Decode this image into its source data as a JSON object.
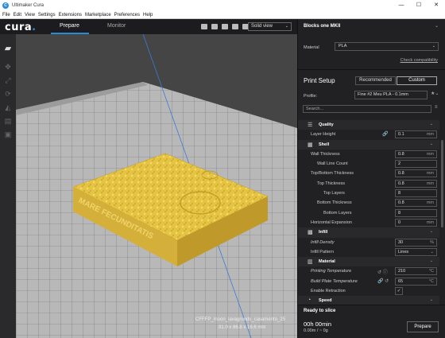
{
  "window": {
    "title": "Ultimaker Cura",
    "controls": [
      "—",
      "☐",
      "✕"
    ]
  },
  "menubar": [
    "File",
    "Edit",
    "View",
    "Settings",
    "Extensions",
    "Marketplace",
    "Preferences",
    "Help"
  ],
  "header": {
    "logo": "cura",
    "logo_dot": ".",
    "tabs": {
      "prepare": "Prepare",
      "monitor": "Monitor"
    },
    "view_mode": "Solid view",
    "view_icons": [
      "view-3d-icon",
      "view-front-icon",
      "view-top-icon",
      "view-left-icon",
      "view-right-icon"
    ]
  },
  "toolbar": {
    "open_icon": "📂",
    "tools": [
      "move-icon",
      "scale-icon",
      "rotate-icon",
      "mirror-icon",
      "per-model-settings-icon",
      "support-blocker-icon"
    ]
  },
  "viewport": {
    "model_name": "CFFFP_moon_lavagrunds_casamento_25",
    "model_dims": "81.0 x 86.8 x 16.6 mm",
    "model_text": "MARE FECUNDITATIS",
    "model_color": "#e8c646"
  },
  "panel": {
    "printer": "Blocks one MKII",
    "material_label": "Material",
    "material": "PLA",
    "check_compat": "Check compatibility",
    "print_setup": "Print Setup",
    "mode_recommended": "Recommended",
    "mode_custom": "Custom",
    "profile_label": "Profile:",
    "profile": "Fine #2 Meu PLA - 0.1mm",
    "search_placeholder": "Search..."
  },
  "settings": [
    {
      "type": "cat",
      "label": "Quality",
      "icon": "☰"
    },
    {
      "type": "row",
      "label": "Layer Height",
      "indent": 16,
      "value": "0.1",
      "unit": "mm",
      "icons": "🔗"
    },
    {
      "type": "cat",
      "label": "Shell",
      "icon": "▦"
    },
    {
      "type": "row",
      "label": "Wall Thickness",
      "indent": 16,
      "value": "0.8",
      "unit": "mm"
    },
    {
      "type": "row",
      "label": "Wall Line Count",
      "indent": 24,
      "value": "2",
      "unit": ""
    },
    {
      "type": "row",
      "label": "Top/Bottom Thickness",
      "indent": 16,
      "value": "0.8",
      "unit": "mm"
    },
    {
      "type": "row",
      "label": "Top Thickness",
      "indent": 24,
      "value": "0.8",
      "unit": "mm"
    },
    {
      "type": "row",
      "label": "Top Layers",
      "indent": 32,
      "value": "8",
      "unit": ""
    },
    {
      "type": "row",
      "label": "Bottom Thickness",
      "indent": 24,
      "value": "0.8",
      "unit": "mm"
    },
    {
      "type": "row",
      "label": "Bottom Layers",
      "indent": 32,
      "value": "8",
      "unit": ""
    },
    {
      "type": "row",
      "label": "Horizontal Expansion",
      "indent": 16,
      "value": "0",
      "unit": "mm"
    },
    {
      "type": "cat",
      "label": "Infill",
      "icon": "▩"
    },
    {
      "type": "row",
      "label": "Infill Density",
      "indent": 16,
      "value": "30",
      "unit": "%",
      "italic": true
    },
    {
      "type": "row",
      "label": "Infill Pattern",
      "indent": 16,
      "value": "Lines",
      "unit": "⌄"
    },
    {
      "type": "cat",
      "label": "Material",
      "icon": "▥"
    },
    {
      "type": "row",
      "label": "Printing Temperature",
      "indent": 16,
      "value": "210",
      "unit": "°C",
      "italic": true,
      "icons": "↺ ⓘ"
    },
    {
      "type": "row",
      "label": "Build Plate Temperature",
      "indent": 16,
      "value": "65",
      "unit": "°C",
      "italic": true,
      "icons": "🔗 ↺"
    },
    {
      "type": "check",
      "label": "Enable Retraction",
      "indent": 16,
      "value": "✓"
    },
    {
      "type": "cat",
      "label": "Speed",
      "icon": "◔"
    }
  ],
  "slice": {
    "ready": "Ready to slice",
    "time": "00h 00min",
    "weight": "0.00m / ~ 0g",
    "button": "Prepare"
  }
}
